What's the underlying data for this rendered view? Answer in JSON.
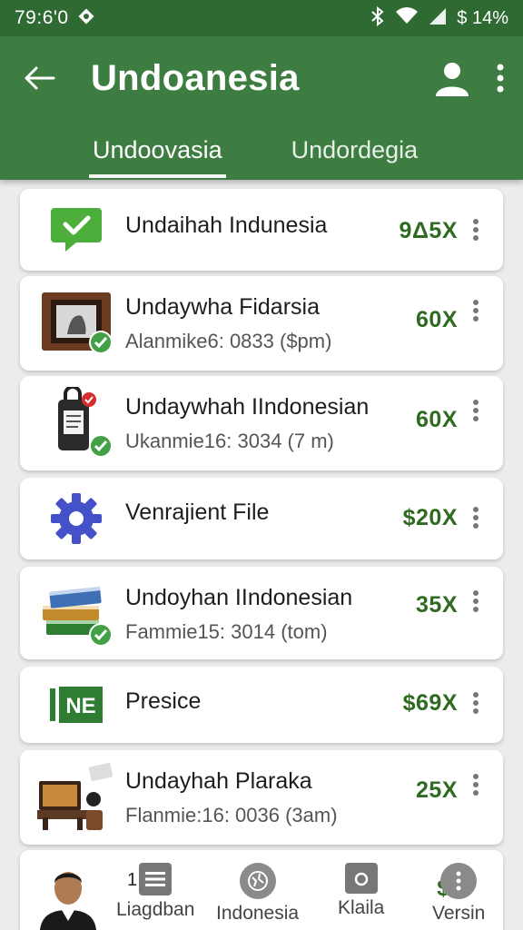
{
  "status_bar": {
    "time": "79:6'0",
    "battery": "$ 14%"
  },
  "app_bar": {
    "title": "Undoanesia",
    "tabs": [
      "Undoovasia",
      "Undordegia"
    ]
  },
  "items": [
    {
      "title": "Undaihah Indunesia",
      "subtitle": "",
      "value": "9Δ5X",
      "icon": "chat-check-icon"
    },
    {
      "title": "Undaywha Fidarsia",
      "subtitle": "Alanmike6: 0833 ($pm)",
      "value": "60X",
      "icon": "framed-picture-icon"
    },
    {
      "title": "Undaywhah IIndonesian",
      "subtitle": "Ukanmie16: 3034 (7 m)",
      "value": "60X",
      "icon": "phone-bag-icon"
    },
    {
      "title": "Venrajient File",
      "subtitle": "",
      "value": "$20X",
      "icon": "gear-icon"
    },
    {
      "title": "Undoyhan IIndonesian",
      "subtitle": "Fammie15: 3014 (tom)",
      "value": "35X",
      "icon": "books-icon"
    },
    {
      "title": "Presice",
      "subtitle": "",
      "value": "$69X",
      "icon": "ne-logo-icon"
    },
    {
      "title": "Undayhah Plaraka",
      "subtitle": "Flanmie:16: 0036 (3am)",
      "value": "25X",
      "icon": "desk-tv-icon"
    }
  ],
  "bottom": {
    "overlay_text": "1: ap",
    "value": "$4",
    "nav": [
      {
        "label": "Liagdban",
        "icon": "list-icon"
      },
      {
        "label": "Indonesia",
        "icon": "globe-icon"
      },
      {
        "label": "Klaila",
        "icon": "camera-icon"
      },
      {
        "label": "Versin",
        "icon": "more-icon"
      }
    ]
  },
  "colors": {
    "primary": "#3e7d42",
    "status_bar": "#2f6a33",
    "value_green": "#2e6a1f",
    "check_green": "#43a047"
  }
}
